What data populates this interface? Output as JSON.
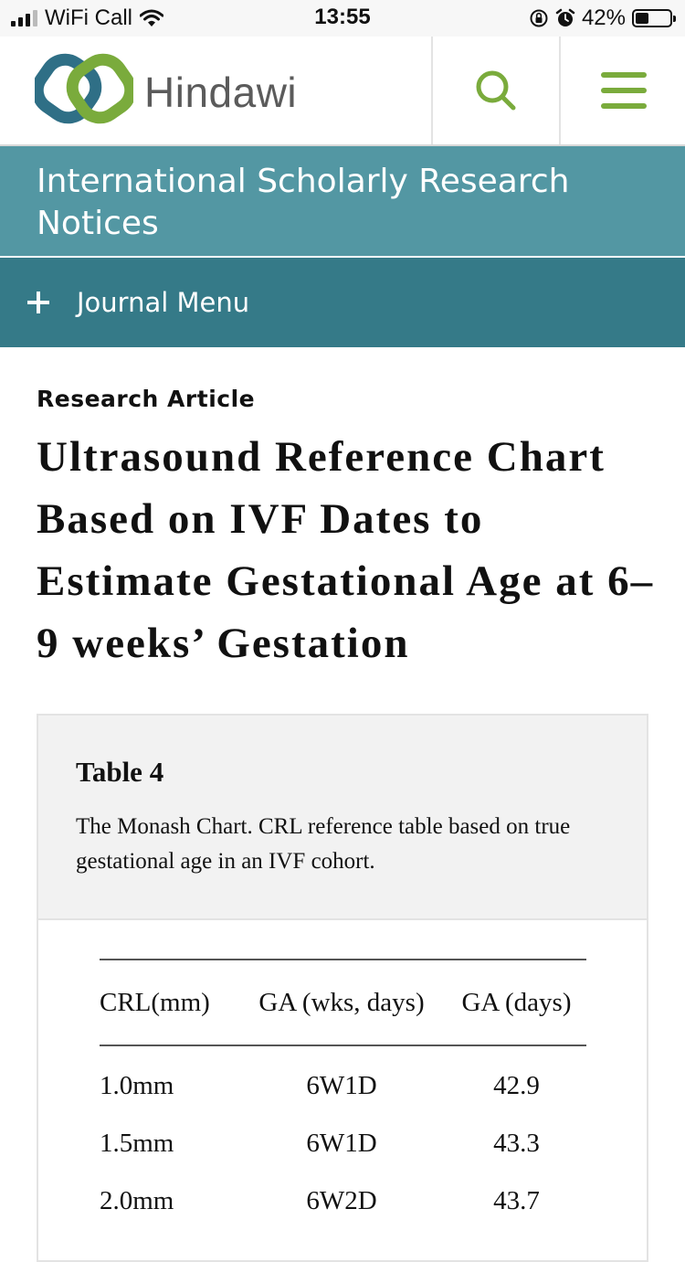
{
  "status_bar": {
    "carrier": "WiFi Call",
    "time": "13:55",
    "battery_percent": "42%"
  },
  "header": {
    "brand": "Hindawi",
    "colors": {
      "green": "#7aab3c",
      "teal": "#2f6f86",
      "brand_text": "#5b5b5b"
    }
  },
  "journal": {
    "title": "International Scholarly Research Notices",
    "menu_label": "Journal Menu",
    "colors": {
      "title_bg": "#5397a3",
      "menu_bg": "#357a88"
    }
  },
  "article": {
    "type": "Research Article",
    "title": "Ultrasound Reference Chart Based on IVF Dates to Estimate Gestational Age at 6–9 weeks’ Gestation"
  },
  "table": {
    "title": "Table 4",
    "description": "The Monash Chart. CRL reference table based on true gestational age in an IVF cohort.",
    "columns": [
      "CRL(mm)",
      "GA (wks, days)",
      "GA (days)"
    ],
    "rows": [
      [
        "1.0mm",
        "6W1D",
        "42.9"
      ],
      [
        "1.5mm",
        "6W1D",
        "43.3"
      ],
      [
        "2.0mm",
        "6W2D",
        "43.7"
      ]
    ]
  }
}
